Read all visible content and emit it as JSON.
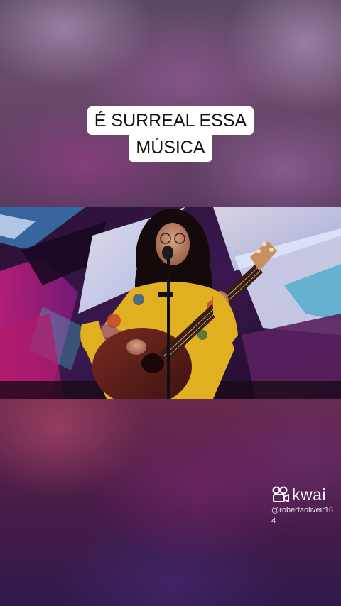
{
  "caption": {
    "line1": "É SURREAL ESSA",
    "line2": "MÚSICA"
  },
  "watermark": {
    "brand": "kwai",
    "handle_line1": "@robertaoliveir16",
    "handle_line2": "4",
    "icon": "kwai-camera-logo-icon"
  },
  "video": {
    "scene": "singer-with-guitar-stage-icon"
  },
  "colors": {
    "caption_bg": "#ffffff",
    "caption_text": "#111111",
    "watermark_text": "#ffffff"
  }
}
